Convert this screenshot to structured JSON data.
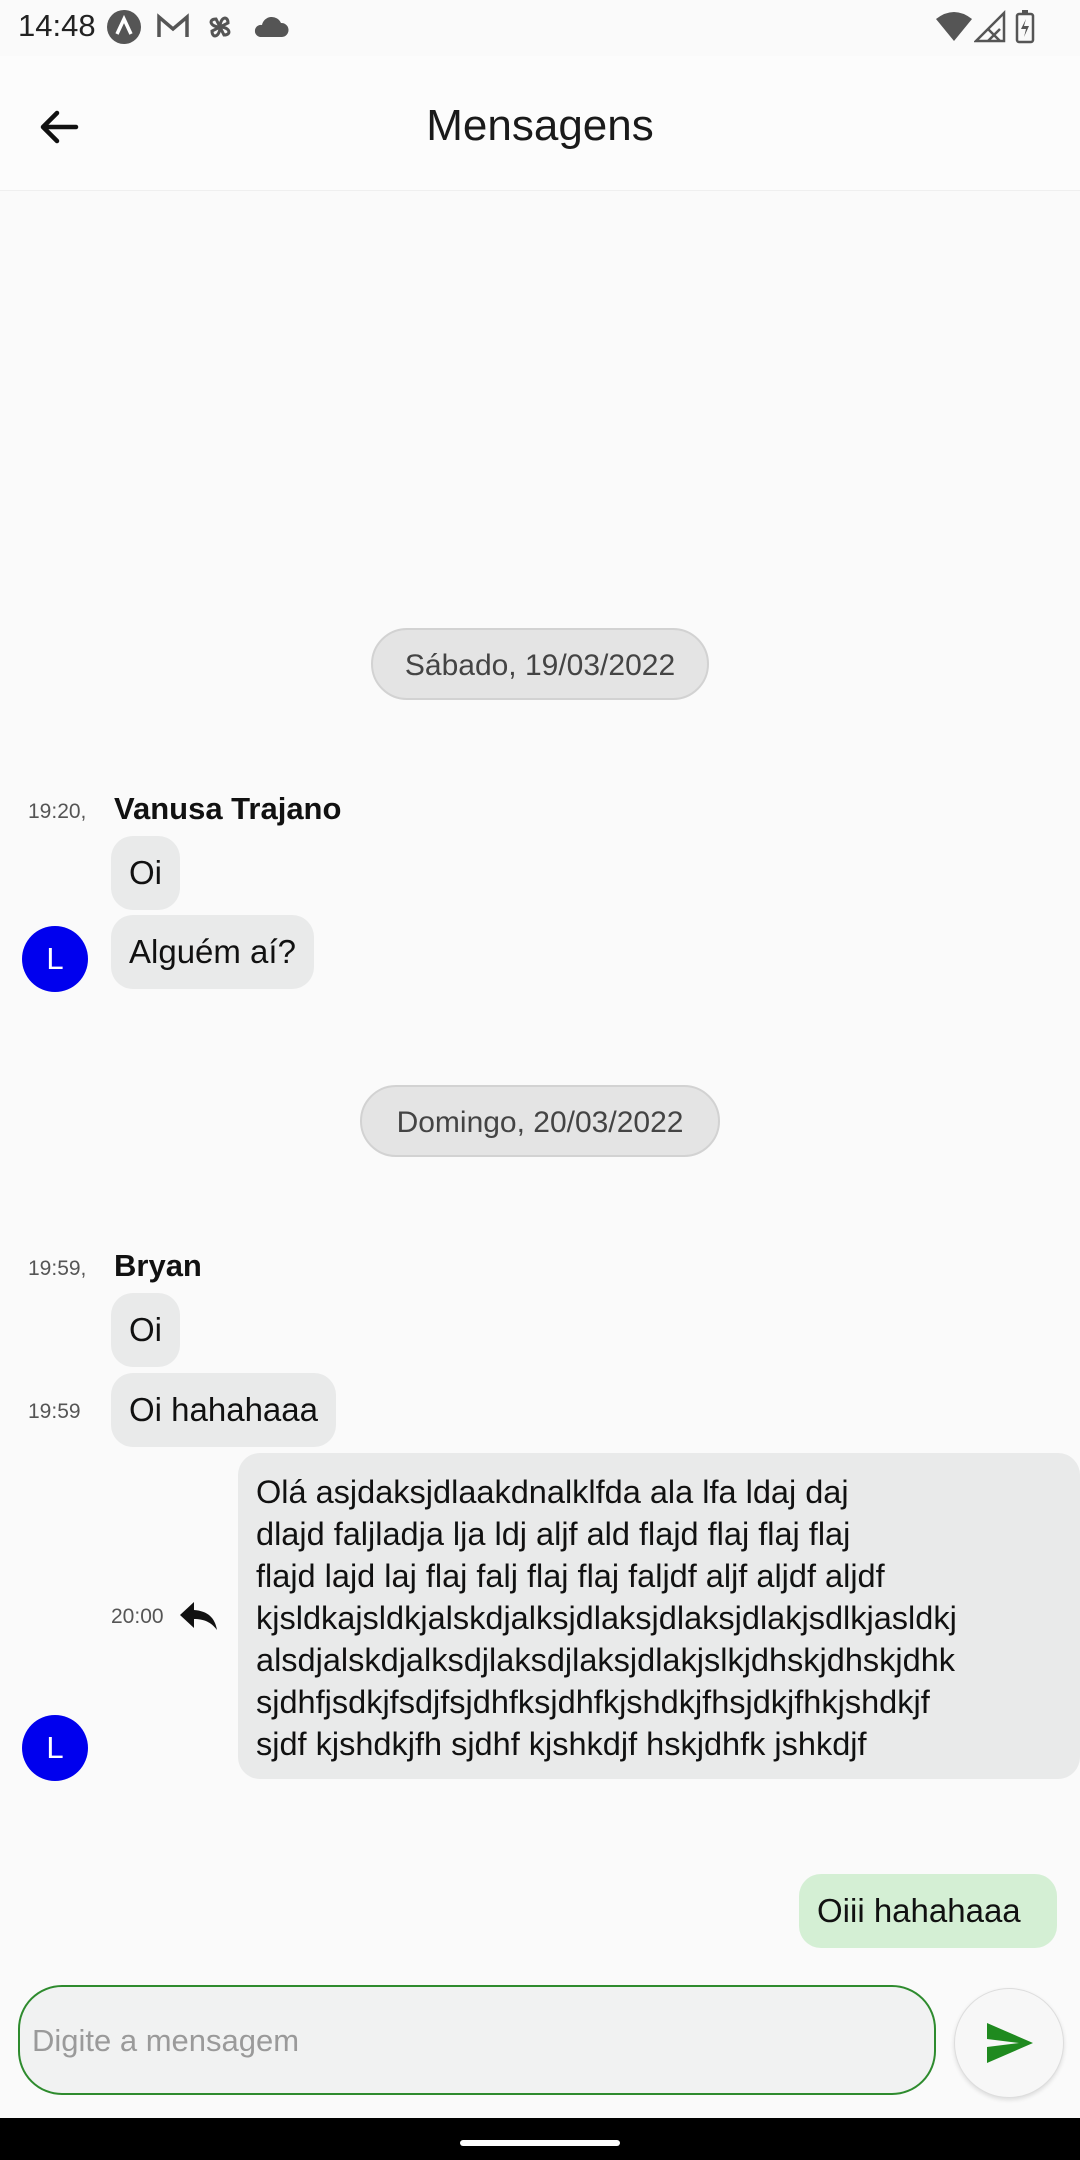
{
  "status_bar": {
    "time": "14:48",
    "left_icons": [
      "app-a-icon",
      "gmail-icon",
      "pinwheel-icon",
      "cloud-icon"
    ],
    "right_icons": [
      "wifi-icon",
      "signal-icon",
      "battery-icon"
    ]
  },
  "header": {
    "title": "Mensagens",
    "back_icon": "arrow-left-icon"
  },
  "conversation": {
    "day1": {
      "date_label": "Sábado, 19/03/2022",
      "group": {
        "time": "19:20,",
        "sender": "Vanusa Trajano",
        "messages": [
          "Oi",
          "Alguém aí?"
        ],
        "avatar_letter": "L"
      }
    },
    "day2": {
      "date_label": "Domingo, 20/03/2022",
      "group": {
        "time": "19:59,",
        "sender": "Bryan",
        "messages": [
          {
            "text": "Oi"
          },
          {
            "time": "19:59",
            "text": "Oi hahahaaa"
          },
          {
            "time": "20:00",
            "reply_icon": "reply-icon",
            "text": "Olá asjdaksjdlaakdnalklfda ala lfa ldaj daj\ndlajd faljladja lja ldj aljf ald flajd flaj flaj flaj\nflajd lajd laj flaj falj flaj flaj faljdf aljf aljdf aljdf\nkjsldkajsldkjalskdjalksjdlaksjdlaksjdlakjsdlkjasldkj\nalsdjalskdjalksdjlaksdjlaksjdlakjslkjdhskjdhskjdhk\nsjdhfjsdkjfsdjfsjdhfksjdhfkjshdkjfhsjdkjfhkjshdkjf\nsjdf kjshdkjfh sjdhf kjshkdjf hskjdhfk jshkdjf"
          }
        ],
        "avatar_letter": "L"
      }
    },
    "my_message": "Oiii hahahaaa"
  },
  "composer": {
    "placeholder": "Digite a mensagem",
    "value": "",
    "send_icon": "send-icon"
  },
  "colors": {
    "accent_green": "#2e8b2e",
    "avatar_blue": "#0000ee",
    "my_bubble": "#d4efd4",
    "their_bubble": "#e9eaea"
  }
}
